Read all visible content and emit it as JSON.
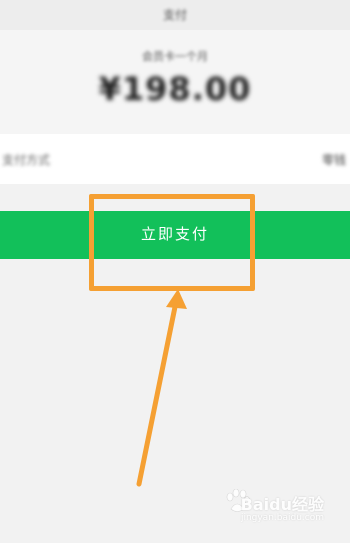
{
  "nav": {
    "title": "支付"
  },
  "payment": {
    "merchant_label": "会员卡一个月",
    "amount": "¥198.00"
  },
  "method": {
    "label": "支付方式",
    "value": "零钱"
  },
  "pay_button": {
    "label": "立即支付"
  },
  "annotation": {
    "highlight_color": "#f5a033",
    "arrow_color": "#f5a033"
  },
  "watermark": {
    "main": "Baidu经验",
    "sub": "jingyan.baidu.com"
  },
  "colors": {
    "accent_green": "#12c05a",
    "page_background": "#f2f2f2"
  }
}
